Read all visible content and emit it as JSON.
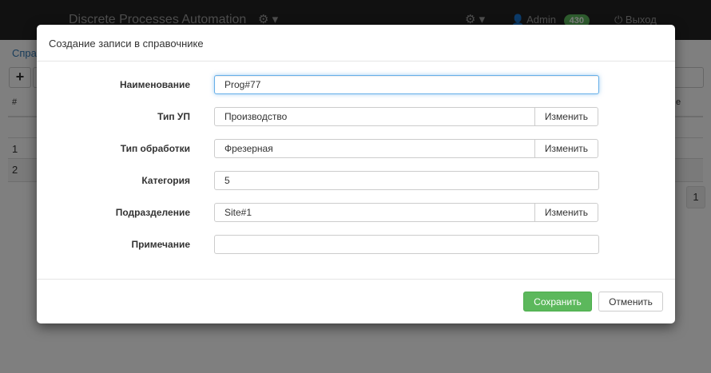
{
  "navbar": {
    "brand": "Discrete Processes Automation",
    "user_name": "Admin",
    "user_badge": "430",
    "logout_label": "Выход"
  },
  "page": {
    "breadcrumb": "Справ",
    "add_label": "+",
    "table_header_hash": "#",
    "table_header_right": "е",
    "rows": [
      "1",
      "2"
    ],
    "pagination_current": "1"
  },
  "modal": {
    "title": "Создание записи в справочнике",
    "fields": {
      "name": {
        "label": "Наименование",
        "value": "Prog#77"
      },
      "up_type": {
        "label": "Тип УП",
        "value": "Производство",
        "change_label": "Изменить"
      },
      "processing_type": {
        "label": "Тип обработки",
        "value": "Фрезерная",
        "change_label": "Изменить"
      },
      "category": {
        "label": "Категория",
        "value": "5"
      },
      "division": {
        "label": "Подразделение",
        "value": "Site#1",
        "change_label": "Изменить"
      },
      "note": {
        "label": "Примечание",
        "value": ""
      }
    },
    "save_label": "Сохранить",
    "cancel_label": "Отменить"
  },
  "colors": {
    "navbar_bg": "#222222",
    "success": "#5cb85c",
    "focus_border": "#66afe9",
    "link": "#337ab7"
  }
}
